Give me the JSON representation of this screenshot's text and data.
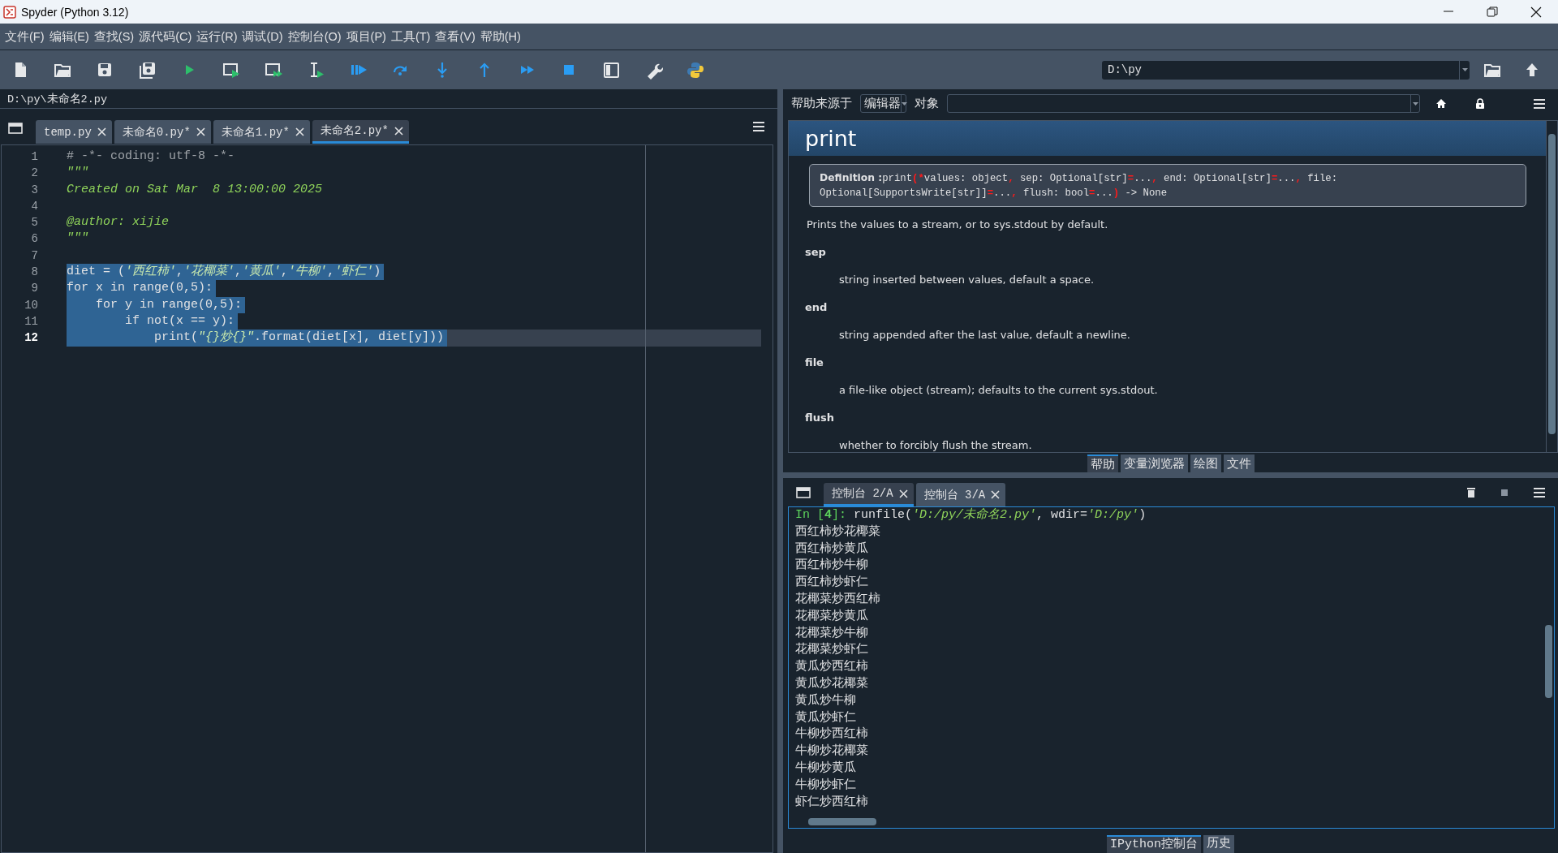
{
  "window": {
    "title": "Spyder (Python 3.12)"
  },
  "menu": [
    "文件(F)",
    "编辑(E)",
    "查找(S)",
    "源代码(C)",
    "运行(R)",
    "调试(D)",
    "控制台(O)",
    "项目(P)",
    "工具(T)",
    "查看(V)",
    "帮助(H)"
  ],
  "toolbar": {
    "working_directory": "D:\\py"
  },
  "editor": {
    "path": "D:\\py\\未命名2.py",
    "tabs": [
      {
        "label": "temp.py",
        "selected": false
      },
      {
        "label": "未命名0.py*",
        "selected": false
      },
      {
        "label": "未命名1.py*",
        "selected": false
      },
      {
        "label": "未命名2.py*",
        "selected": true
      }
    ],
    "lines": [
      {
        "number": "1",
        "selected": false,
        "current": false,
        "tokens": [
          {
            "kind": "comment",
            "text": "# -*- coding: utf-8 -*-"
          }
        ]
      },
      {
        "number": "2",
        "selected": false,
        "current": false,
        "tokens": [
          {
            "kind": "string",
            "text": "\"\"\""
          }
        ]
      },
      {
        "number": "3",
        "selected": false,
        "current": false,
        "tokens": [
          {
            "kind": "string",
            "text": "Created on Sat Mar  8 13:00:00 2025"
          }
        ]
      },
      {
        "number": "4",
        "selected": false,
        "current": false
      },
      {
        "number": "5",
        "selected": false,
        "current": false,
        "tokens": [
          {
            "kind": "string",
            "text": "@author: xijie"
          }
        ]
      },
      {
        "number": "6",
        "selected": false,
        "current": false,
        "tokens": [
          {
            "kind": "string",
            "text": "\"\"\""
          }
        ]
      },
      {
        "number": "7",
        "selected": false,
        "current": false
      },
      {
        "number": "8",
        "selected": true,
        "current": false,
        "tokens": [
          {
            "kind": "plain",
            "text": "diet = ("
          },
          {
            "kind": "string",
            "text": "'西红柿'"
          },
          {
            "kind": "plain",
            "text": ","
          },
          {
            "kind": "string",
            "text": "'花椰菜'"
          },
          {
            "kind": "plain",
            "text": ","
          },
          {
            "kind": "string",
            "text": "'黄瓜'"
          },
          {
            "kind": "plain",
            "text": ","
          },
          {
            "kind": "string",
            "text": "'牛柳'"
          },
          {
            "kind": "plain",
            "text": ","
          },
          {
            "kind": "string",
            "text": "'虾仁'"
          },
          {
            "kind": "plain",
            "text": ")"
          }
        ]
      },
      {
        "number": "9",
        "selected": true,
        "current": false,
        "tokens": [
          {
            "kind": "plain",
            "text": "for x in range(0,5):"
          }
        ]
      },
      {
        "number": "10",
        "selected": true,
        "current": false,
        "tokens": [
          {
            "kind": "plain",
            "text": "    for y in range(0,5):"
          }
        ]
      },
      {
        "number": "11",
        "selected": true,
        "current": false,
        "tokens": [
          {
            "kind": "plain",
            "text": "        if not(x == y):"
          }
        ]
      },
      {
        "number": "12",
        "selected": true,
        "current": true,
        "tokens": [
          {
            "kind": "plain",
            "text": "            print("
          },
          {
            "kind": "string",
            "text": "\"{}炒{}\""
          },
          {
            "kind": "plain",
            "text": ".format(diet[x], diet[y]))"
          }
        ]
      }
    ]
  },
  "help": {
    "source_label": "帮助来源于",
    "source": "编辑器",
    "object_label": "对象",
    "title": "print",
    "definition_label": "Definition :",
    "definition": [
      {
        "kind": "plain",
        "text": "print"
      },
      {
        "kind": "punct",
        "text": "(*"
      },
      {
        "kind": "plain",
        "text": "values: object"
      },
      {
        "kind": "punct",
        "text": ","
      },
      {
        "kind": "plain",
        "text": " sep: Optional[str]"
      },
      {
        "kind": "punct",
        "text": "="
      },
      {
        "kind": "plain",
        "text": "..."
      },
      {
        "kind": "punct",
        "text": ","
      },
      {
        "kind": "plain",
        "text": " end: Optional[str]"
      },
      {
        "kind": "punct",
        "text": "="
      },
      {
        "kind": "plain",
        "text": "..."
      },
      {
        "kind": "punct",
        "text": ","
      },
      {
        "kind": "plain",
        "text": " file: Optional[SupportsWrite[str]]"
      },
      {
        "kind": "punct",
        "text": "="
      },
      {
        "kind": "plain",
        "text": "..."
      },
      {
        "kind": "punct",
        "text": ","
      },
      {
        "kind": "plain",
        "text": " flush: bool"
      },
      {
        "kind": "punct",
        "text": "="
      },
      {
        "kind": "plain",
        "text": "..."
      },
      {
        "kind": "punct",
        "text": ")"
      },
      {
        "kind": "plain",
        "text": " -> None"
      }
    ],
    "summary": "Prints the values to a stream, or to sys.stdout by default.",
    "params": [
      {
        "name": "sep",
        "description": "string inserted between values, default a space."
      },
      {
        "name": "end",
        "description": "string appended after the last value, default a newline."
      },
      {
        "name": "file",
        "description": "a file-like object (stream); defaults to the current sys.stdout."
      },
      {
        "name": "flush",
        "description": "whether to forcibly flush the stream."
      }
    ],
    "tabs": [
      {
        "label": "帮助",
        "selected": true
      },
      {
        "label": "变量浏览器",
        "selected": false
      },
      {
        "label": "绘图",
        "selected": false
      },
      {
        "label": "文件",
        "selected": false
      }
    ]
  },
  "console": {
    "tabs": [
      {
        "label": "控制台 2/A",
        "selected": true
      },
      {
        "label": "控制台 3/A",
        "selected": false
      }
    ],
    "command": [
      {
        "kind": "prompt",
        "text": "In ["
      },
      {
        "kind": "number",
        "text": "4"
      },
      {
        "kind": "prompt",
        "text": "]: "
      },
      {
        "kind": "plain",
        "text": "runfile("
      },
      {
        "kind": "string",
        "text": "'D:/py/未命名2.py'"
      },
      {
        "kind": "plain",
        "text": ", wdir="
      },
      {
        "kind": "string",
        "text": "'D:/py'"
      },
      {
        "kind": "plain",
        "text": ")"
      }
    ],
    "output": [
      "西红柿炒花椰菜",
      "西红柿炒黄瓜",
      "西红柿炒牛柳",
      "西红柿炒虾仁",
      "花椰菜炒西红柿",
      "花椰菜炒黄瓜",
      "花椰菜炒牛柳",
      "花椰菜炒虾仁",
      "黄瓜炒西红柿",
      "黄瓜炒花椰菜",
      "黄瓜炒牛柳",
      "黄瓜炒虾仁",
      "牛柳炒西红柿",
      "牛柳炒花椰菜",
      "牛柳炒黄瓜",
      "牛柳炒虾仁",
      "虾仁炒西红柿"
    ],
    "bottom_tabs": [
      {
        "label": "IPython控制台",
        "selected": true
      },
      {
        "label": "历史",
        "selected": false
      }
    ]
  }
}
